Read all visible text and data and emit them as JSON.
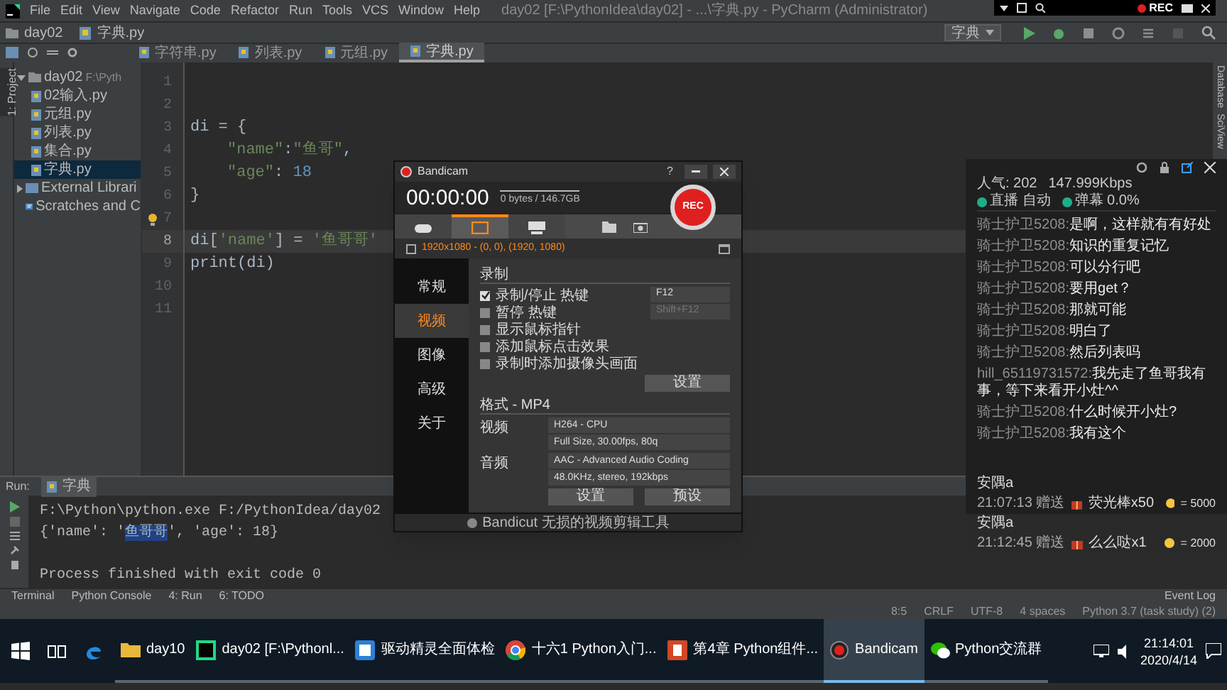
{
  "ide": {
    "menu": [
      "File",
      "Edit",
      "View",
      "Navigate",
      "Code",
      "Refactor",
      "Run",
      "Tools",
      "VCS",
      "Window",
      "Help"
    ],
    "title": "day02 [F:\\PythonIdea\\day02] - ...\\字典.py - PyCharm (Administrator)",
    "breadcrumbs": [
      "day02",
      "字典.py"
    ],
    "run_config": "字典",
    "side_tab": "1: Project",
    "right_tabs": [
      "Database",
      "SciView"
    ],
    "editor_tabs": [
      {
        "label": "字符串.py",
        "selected": false
      },
      {
        "label": "列表.py",
        "selected": false
      },
      {
        "label": "元组.py",
        "selected": false
      },
      {
        "label": "字典.py",
        "selected": true
      }
    ],
    "project_tree": [
      {
        "label": "day02",
        "path": "F:\\Pyth",
        "kind": "folder",
        "expanded": true,
        "children": [
          {
            "label": "02输入.py",
            "kind": "file",
            "selected": false
          },
          {
            "label": "元组.py",
            "kind": "file",
            "selected": false
          },
          {
            "label": "列表.py",
            "kind": "file",
            "selected": false
          },
          {
            "label": "集合.py",
            "kind": "file",
            "selected": false
          },
          {
            "label": "字典.py",
            "kind": "file",
            "selected": true
          }
        ]
      },
      {
        "label": "External Librari",
        "kind": "library",
        "expanded": false
      },
      {
        "label": "Scratches and C",
        "kind": "scratch"
      }
    ],
    "code_lines": [
      {
        "number": "1",
        "current": false
      },
      {
        "number": "2",
        "current": false
      },
      {
        "number": "3",
        "current": false,
        "tokens": [
          {
            "kind": "plain",
            "text": "di = {"
          }
        ]
      },
      {
        "number": "4",
        "current": false,
        "indent": true,
        "tokens": [
          {
            "kind": "string",
            "text": "\"name\""
          },
          {
            "kind": "plain",
            "text": ":"
          },
          {
            "kind": "string",
            "text": "\"鱼哥\""
          },
          {
            "kind": "plain",
            "text": ","
          }
        ]
      },
      {
        "number": "5",
        "current": false,
        "indent": true,
        "tokens": [
          {
            "kind": "string",
            "text": "\"age\""
          },
          {
            "kind": "plain",
            "text": ": "
          },
          {
            "kind": "number",
            "text": "18"
          }
        ]
      },
      {
        "number": "6",
        "current": false,
        "tokens": [
          {
            "kind": "plain",
            "text": "}"
          }
        ]
      },
      {
        "number": "7",
        "current": false
      },
      {
        "number": "8",
        "current": true,
        "tokens": [
          {
            "kind": "plain",
            "text": "di["
          },
          {
            "kind": "string",
            "text": "'name'"
          },
          {
            "kind": "plain",
            "text": "] = "
          },
          {
            "kind": "string",
            "text": "'鱼哥哥'"
          }
        ]
      },
      {
        "number": "9",
        "current": false,
        "tokens": [
          {
            "kind": "plain",
            "text": "print(di)"
          }
        ]
      },
      {
        "number": "10",
        "current": false
      },
      {
        "number": "11",
        "current": false
      }
    ],
    "run": {
      "label": "Run:",
      "tab": "字典",
      "output": [
        {
          "kind": "command",
          "parts": [
            {
              "text": "F:\\Python\\python.exe F:/PythonIdea/day02",
              "selected": false
            }
          ]
        },
        {
          "kind": "result",
          "parts": [
            {
              "text": "{'name': '",
              "selected": false
            },
            {
              "text": "鱼哥哥",
              "selected": true
            },
            {
              "text": "', 'age': 18}",
              "selected": false
            }
          ]
        },
        {
          "kind": "exit",
          "parts": [
            {
              "text": "Process finished with exit code 0",
              "selected": false
            }
          ]
        }
      ]
    },
    "tool_tabs": [
      "Terminal",
      "Python Console",
      "4: Run",
      "6: TODO"
    ],
    "event_log": "Event Log",
    "status": [
      "8:5",
      "CRLF",
      "UTF-8",
      "4 spaces",
      "Python 3.7 (task study) (2)"
    ]
  },
  "recorder_bar": {
    "label": "REC"
  },
  "bandicam": {
    "title": "Bandicam",
    "help": "?",
    "timer": "00:00:00",
    "size": "0 bytes / 146.7GB",
    "rec": "REC",
    "modes": [
      {
        "kind": "game",
        "selected": false
      },
      {
        "kind": "screen",
        "selected": true
      },
      {
        "kind": "device",
        "selected": false
      }
    ],
    "area_checked": false,
    "area": "1920x1080 - (0, 0), (1920, 1080)",
    "menu": [
      {
        "label": "常规",
        "selected": false
      },
      {
        "label": "视频",
        "selected": true
      },
      {
        "label": "图像",
        "selected": false
      },
      {
        "label": "高级",
        "selected": false
      },
      {
        "label": "关于",
        "selected": false
      }
    ],
    "section": "录制",
    "options": [
      {
        "label": "录制/停止 热键",
        "checked": true
      },
      {
        "label": "暂停 热键",
        "checked": false
      },
      {
        "label": "显示鼠标指针",
        "checked": false
      },
      {
        "label": "添加鼠标点击效果",
        "checked": false
      },
      {
        "label": "录制时添加摄像头画面",
        "checked": false
      }
    ],
    "hotkeys": [
      "F12",
      "Shift+F12"
    ],
    "settings_button": "设置",
    "format": "格式 - MP4",
    "video_label": "视频",
    "video": [
      "H264 - CPU",
      "Full Size, 30.00fps, 80q"
    ],
    "audio_label": "音频",
    "audio": [
      "AAC - Advanced Audio Coding",
      "48.0KHz, stereo, 192kbps"
    ],
    "buttons": [
      "设置",
      "预设"
    ],
    "footer": "Bandicut 无损的视频剪辑工具"
  },
  "chat": {
    "stats": [
      "人气: 202",
      "147.999Kbps",
      "直播 自动",
      "弹幕 0.0%"
    ],
    "messages": [
      {
        "user": "骑士护卫5208:",
        "text": "是啊，这样就有有好处"
      },
      {
        "user": "骑士护卫5208:",
        "text": "知识的重复记忆"
      },
      {
        "user": "骑士护卫5208:",
        "text": "可以分行吧"
      },
      {
        "user": "骑士护卫5208:",
        "text": "要用get？"
      },
      {
        "user": "骑士护卫5208:",
        "text": "那就可能"
      },
      {
        "user": "骑士护卫5208:",
        "text": "明白了"
      },
      {
        "user": "骑士护卫5208:",
        "text": "然后列表吗"
      },
      {
        "user": "hill_65119731572:",
        "text": "我先走了鱼哥我有事，等下来看开小灶^^"
      },
      {
        "user": "骑士护卫5208:",
        "text": "什么时候开小灶?"
      },
      {
        "user": "骑士护卫5208:",
        "text": "我有这个"
      }
    ],
    "gifts": [
      {
        "user": "安隅a",
        "time": "21:07:13 赠送",
        "gift": "荧光棒x50",
        "value": "= 5000"
      },
      {
        "user": "安隅a",
        "time": "21:12:45 赠送",
        "gift": "么么哒x1",
        "value": "= 2000"
      }
    ]
  },
  "taskbar": {
    "apps": [
      {
        "kind": "folder",
        "label": "day10",
        "selected": false
      },
      {
        "kind": "pycharm",
        "label": "day02 [F:\\Pythonl...",
        "selected": false
      },
      {
        "kind": "app",
        "label": "驱动精灵全面体检",
        "selected": false
      },
      {
        "kind": "chrome",
        "label": "十六1 Python入门...",
        "selected": false
      },
      {
        "kind": "ppt",
        "label": "第4章 Python组件...",
        "selected": false
      },
      {
        "kind": "bandicam",
        "label": "Bandicam",
        "selected": true
      },
      {
        "kind": "wechat",
        "label": "Python交流群",
        "selected": false
      }
    ],
    "time": "21:14:01",
    "date": "2020/4/14"
  }
}
